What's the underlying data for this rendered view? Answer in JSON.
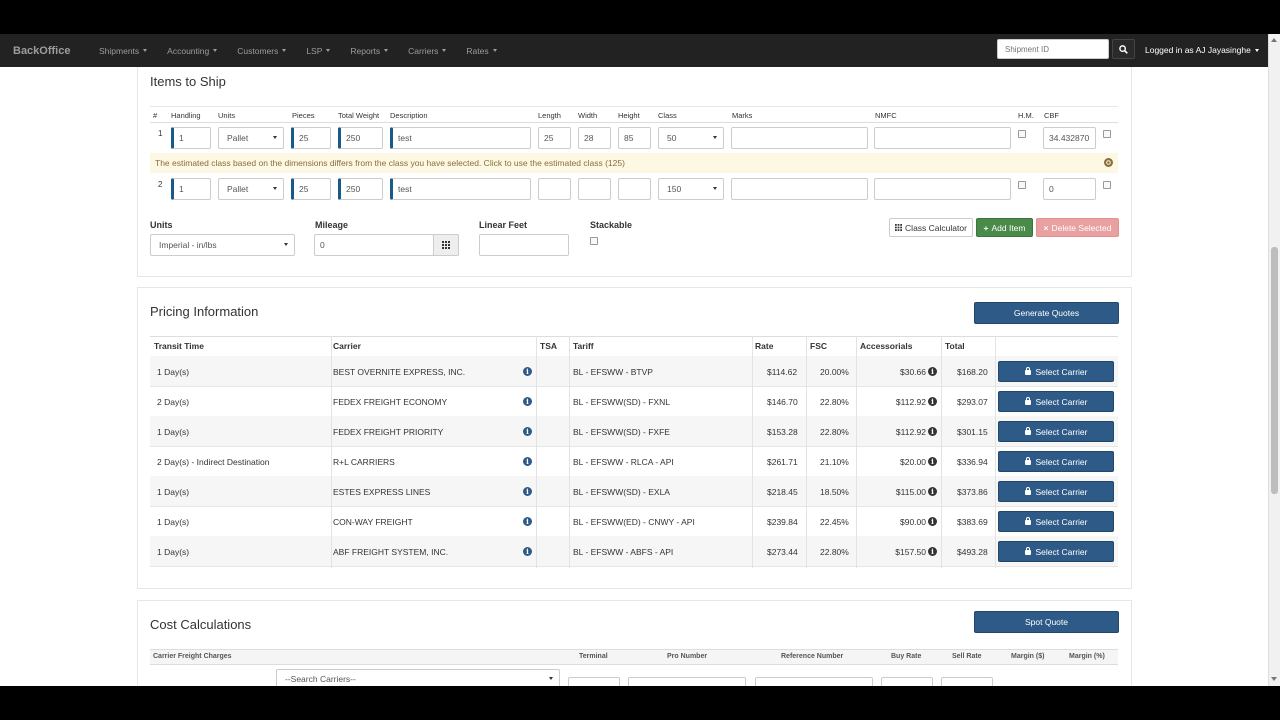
{
  "nav": {
    "brand": "BackOffice",
    "menu": [
      {
        "label": "Shipments"
      },
      {
        "label": "Accounting"
      },
      {
        "label": "Customers"
      },
      {
        "label": "LSP"
      },
      {
        "label": "Reports"
      },
      {
        "label": "Carriers"
      },
      {
        "label": "Rates"
      }
    ],
    "search_placeholder": "Shipment ID",
    "user": "Logged in as AJ Jayasinghe"
  },
  "items": {
    "title": "Items to Ship",
    "headers": {
      "num": "#",
      "handling": "Handling",
      "units": "Units",
      "pieces": "Pieces",
      "weight": "Total Weight",
      "description": "Description",
      "length": "Length",
      "width": "Width",
      "height": "Height",
      "class": "Class",
      "marks": "Marks",
      "nmfc": "NMFC",
      "hm": "H.M.",
      "cbf": "CBF"
    },
    "rows": [
      {
        "num": "1",
        "handling": "1",
        "units": "Pallet",
        "pieces": "25",
        "weight": "250",
        "description": "test",
        "length": "25",
        "width": "28",
        "height": "85",
        "class": "50",
        "marks": "",
        "nmfc": "",
        "cbf": "34.432870"
      },
      {
        "num": "2",
        "handling": "1",
        "units": "Pallet",
        "pieces": "25",
        "weight": "250",
        "description": "test",
        "length": "",
        "width": "",
        "height": "",
        "class": "150",
        "marks": "",
        "nmfc": "",
        "cbf": "0"
      }
    ],
    "warning": "The estimated class based on the dimensions differs from the class you have selected. Click to use the estimated class (125)",
    "units_label": "Units",
    "units_value": "Imperial - in/lbs",
    "mileage_label": "Mileage",
    "mileage_value": "0",
    "linear_feet_label": "Linear Feet",
    "linear_feet_value": "",
    "stackable_label": "Stackable",
    "class_calc": "Class Calculator",
    "add_item": "Add Item",
    "delete_selected": "Delete Selected"
  },
  "pricing": {
    "title": "Pricing Information",
    "generate": "Generate Quotes",
    "headers": {
      "transit": "Transit Time",
      "carrier": "Carrier",
      "tsa": "TSA",
      "tariff": "Tariff",
      "rate": "Rate",
      "fsc": "FSC",
      "accessorials": "Accessorials",
      "total": "Total"
    },
    "select_label": "Select Carrier",
    "rows": [
      {
        "transit": "1 Day(s)",
        "carrier": "BEST OVERNITE EXPRESS, INC.",
        "tariff": "BL - EFSWW - BTVP",
        "rate": "$114.62",
        "fsc": "20.00%",
        "acc": "$30.66",
        "total": "$168.20"
      },
      {
        "transit": "2 Day(s)",
        "carrier": "FEDEX FREIGHT ECONOMY",
        "tariff": "BL - EFSWW(SD) - FXNL",
        "rate": "$146.70",
        "fsc": "22.80%",
        "acc": "$112.92",
        "total": "$293.07"
      },
      {
        "transit": "1 Day(s)",
        "carrier": "FEDEX FREIGHT PRIORITY",
        "tariff": "BL - EFSWW(SD) - FXFE",
        "rate": "$153.28",
        "fsc": "22.80%",
        "acc": "$112.92",
        "total": "$301.15"
      },
      {
        "transit": "2 Day(s)  - Indirect Destination",
        "carrier": "R+L CARRIERS",
        "tariff": "BL - EFSWW - RLCA - API",
        "rate": "$261.71",
        "fsc": "21.10%",
        "acc": "$20.00",
        "total": "$336.94"
      },
      {
        "transit": "1 Day(s)",
        "carrier": "ESTES EXPRESS LINES",
        "tariff": "BL - EFSWW(SD) - EXLA",
        "rate": "$218.45",
        "fsc": "18.50%",
        "acc": "$115.00",
        "total": "$373.86"
      },
      {
        "transit": "1 Day(s)",
        "carrier": "CON-WAY FREIGHT",
        "tariff": "BL - EFSWW(ED) - CNWY - API",
        "rate": "$239.84",
        "fsc": "22.45%",
        "acc": "$90.00",
        "total": "$383.69"
      },
      {
        "transit": "1 Day(s)",
        "carrier": "ABF FREIGHT SYSTEM, INC.",
        "tariff": "BL - EFSWW - ABFS - API",
        "rate": "$273.44",
        "fsc": "22.80%",
        "acc": "$157.50",
        "total": "$493.28"
      }
    ]
  },
  "cost": {
    "title": "Cost Calculations",
    "spot_quote": "Spot Quote",
    "headers": {
      "charges": "Carrier Freight Charges",
      "terminal": "Terminal",
      "pro": "Pro Number",
      "ref": "Reference Number",
      "buy": "Buy Rate",
      "sell": "Sell Rate",
      "margin_usd": "Margin ($)",
      "margin_pct": "Margin (%)"
    },
    "search_carriers": "--Search Carriers--"
  },
  "colors": {
    "primary": "#2e5a87",
    "success": "#4a8a4a",
    "danger": "#e8a0a0",
    "warning_bg": "#fcf8e3"
  }
}
